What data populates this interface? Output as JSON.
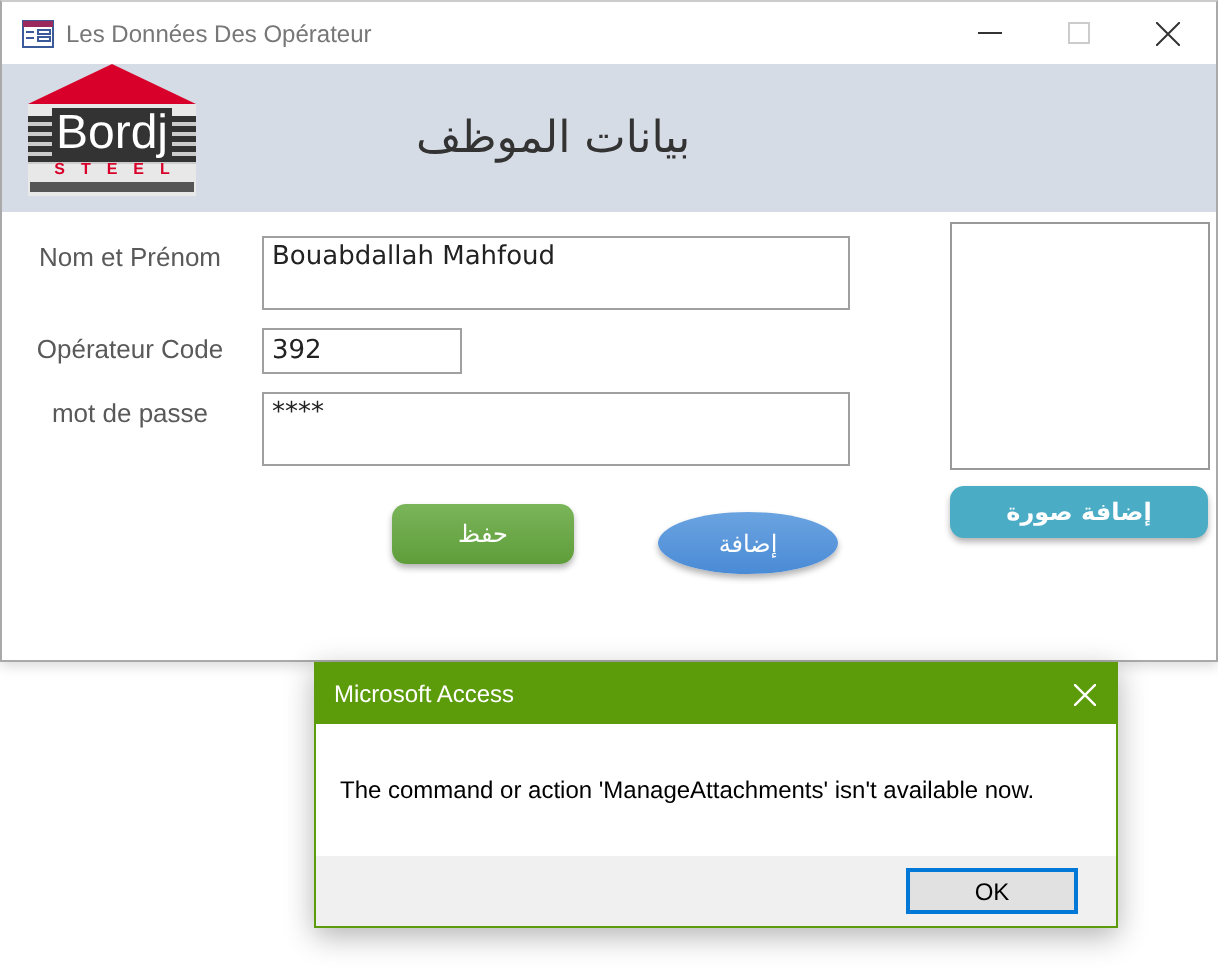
{
  "window": {
    "title": "Les Données Des Opérateur"
  },
  "header": {
    "logo": {
      "name": "Bordj",
      "subtitle": "STEEL"
    },
    "title": "بيانات الموظف"
  },
  "fields": [
    {
      "label": "Nom et Prénom",
      "value": "Bouabdallah Mahfoud",
      "kind": "large"
    },
    {
      "label": "Opérateur Code",
      "value": "392",
      "kind": "small"
    },
    {
      "label": "mot de passe",
      "value": "****",
      "kind": "large"
    }
  ],
  "photo": {
    "button": "إضافة صورة"
  },
  "buttons": [
    {
      "label": "حفظ",
      "kind": "rounded"
    },
    {
      "label": "إضافة",
      "kind": "oval"
    }
  ],
  "dialog": {
    "title": "Microsoft Access",
    "message": "The command or action 'ManageAttachments' isn't available now.",
    "buttons": [
      {
        "label": "OK",
        "selected": true
      }
    ]
  }
}
